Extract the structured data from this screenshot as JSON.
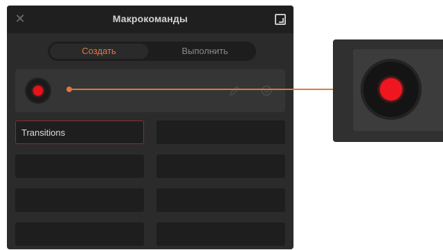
{
  "window": {
    "title": "Макрокоманды",
    "close_icon": "close-icon",
    "popout_icon": "popout-icon"
  },
  "tabs": [
    {
      "label": "Создать",
      "active": true
    },
    {
      "label": "Выполнить",
      "active": false
    }
  ],
  "record": {
    "icon": "record-icon",
    "edit_icon": "pencil-icon",
    "settings_icon": "settings-icon"
  },
  "macros": [
    {
      "label": "Transitions",
      "selected": true
    },
    {
      "label": ""
    },
    {
      "label": ""
    },
    {
      "label": ""
    },
    {
      "label": ""
    },
    {
      "label": ""
    },
    {
      "label": ""
    },
    {
      "label": ""
    }
  ],
  "colors": {
    "accent": "#e0783a",
    "record_red": "#e8121a",
    "panel_bg": "#2b2b2b",
    "selected_border": "#8a2c36"
  }
}
